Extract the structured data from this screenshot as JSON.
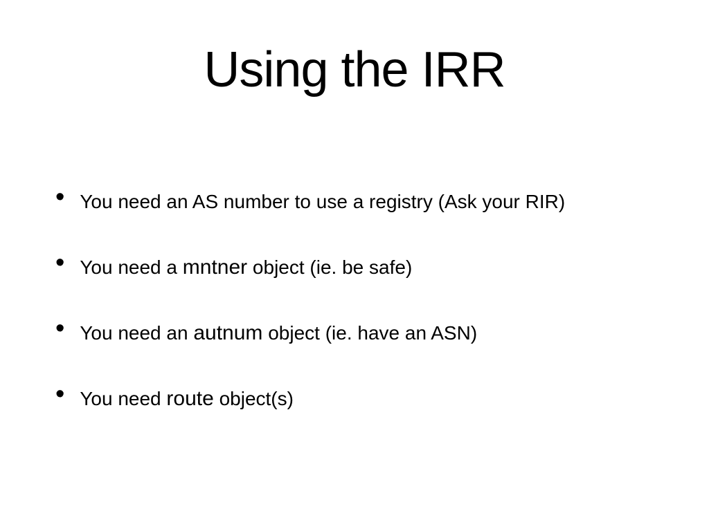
{
  "slide": {
    "title": "Using the IRR",
    "bullets": [
      {
        "pre": "You need an AS number to use a registry  (Ask your RIR)",
        "kw": "",
        "post": ""
      },
      {
        "pre": "You need a ",
        "kw": "mntner",
        "post": " object (ie. be safe)"
      },
      {
        "pre": "You need an ",
        "kw": "autnum",
        "post": " object  (ie.  have an ASN)"
      },
      {
        "pre": "You need ",
        "kw": "route",
        "post": " object(s)"
      }
    ]
  }
}
